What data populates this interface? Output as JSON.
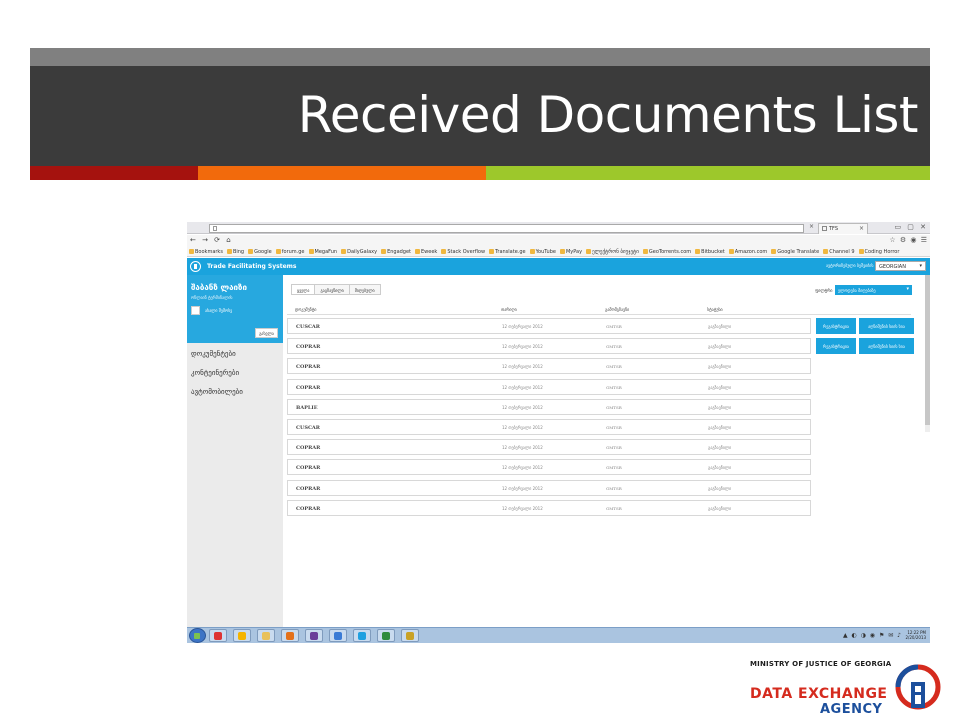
{
  "slide": {
    "title": "Received Documents List",
    "colors": {
      "band": "#3b3b3b",
      "red": "#a5120e",
      "orange": "#f26a0c",
      "green": "#9dc82b"
    }
  },
  "browser": {
    "tab_title": "TFS",
    "bookmarks": [
      "Bookmarks",
      "Bing",
      "Google",
      "forum.ge",
      "MegaFun",
      "DailyGalaxy",
      "Engadget",
      "Eweek",
      "Stack Overflow",
      "Translate.ge",
      "YouTube",
      "MyPay",
      "ელექტრონ ბიუჯეტი",
      "GeoTorrents.com",
      "Bitbucket",
      "Amazon.com",
      "Google Translate",
      "Channel 9",
      "Coding Horror"
    ]
  },
  "app": {
    "title": "Trade Facilitating Systems",
    "header_user_text": "ავტორიზებული ბეშვიძის ვისკ",
    "language": "GEORGIAN",
    "accent": "#1aa3dd",
    "user": {
      "name": "შაბანზ ლაიზი",
      "role": "ონლაინ ტერმინალის",
      "profile_link": "ახალი შემოსვ",
      "exit_button": "გასვლა"
    },
    "menu": [
      "დოკუმენტები",
      "კონტეინერები",
      "ავტომობილები"
    ],
    "tabs": [
      "ყველა",
      "გაგზავნილი",
      "მიღებული"
    ],
    "status_label": "ფილტრი",
    "status_value": "ელოდება მიღებაზე",
    "columns": [
      "დოკუმენტი",
      "თარიღი",
      "გამომგზავნი",
      "სტატუსი"
    ],
    "action_accept": "რეგისტრაცია",
    "action_reject": "აღნიშვნის სიის სია",
    "rows": [
      {
        "type": "CUSCAR",
        "date": "12 თებერვალი 2012",
        "sender": "GMTSR",
        "status": "გაგზავნილი",
        "actions": true
      },
      {
        "type": "COPRAR",
        "date": "12 თებერვალი 2012",
        "sender": "GMTSR",
        "status": "გაგზავნილი",
        "actions": true
      },
      {
        "type": "COPRAR",
        "date": "12 თებერვალი 2012",
        "sender": "GMTSR",
        "status": "გაგზავნილი",
        "actions": false
      },
      {
        "type": "COPRAR",
        "date": "12 თებერვალი 2012",
        "sender": "GMTSR",
        "status": "გაგზავნილი",
        "actions": false
      },
      {
        "type": "BAPLIE",
        "date": "12 თებერვალი 2012",
        "sender": "GMTSR",
        "status": "გაგზავნილი",
        "actions": false
      },
      {
        "type": "CUSCAR",
        "date": "12 თებერვალი 2012",
        "sender": "GMTSR",
        "status": "გაგზავნილი",
        "actions": false
      },
      {
        "type": "COPRAR",
        "date": "12 თებერვალი 2012",
        "sender": "GMTSR",
        "status": "გაგზავნილი",
        "actions": false
      },
      {
        "type": "COPRAR",
        "date": "12 თებერვალი 2012",
        "sender": "GMTSR",
        "status": "გაგზავნილი",
        "actions": false
      },
      {
        "type": "COPRAR",
        "date": "12 თებერვალი 2012",
        "sender": "GMTSR",
        "status": "გაგზავნილი",
        "actions": false
      },
      {
        "type": "COPRAR",
        "date": "12 თებერვალი 2012",
        "sender": "GMTSR",
        "status": "გაგზავნილი",
        "actions": false
      }
    ]
  },
  "taskbar": {
    "apps": [
      "windows-icon",
      "chrome-icon",
      "explorer-icon",
      "powerpoint-icon",
      "visual-studio-icon",
      "network-icon",
      "skype-icon",
      "excel-icon",
      "notepad-icon"
    ],
    "clock_time": "12:22 PM",
    "clock_date": "2/20/2013"
  },
  "footer": {
    "ministry": "MINISTRY OF JUSTICE OF GEORGIA",
    "agency_line1": "DATA EXCHANGE",
    "agency_line2": "AGENCY"
  }
}
